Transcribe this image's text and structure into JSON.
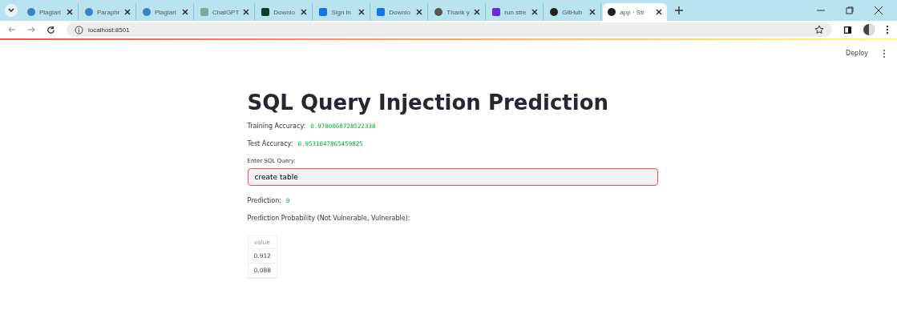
{
  "browser": {
    "tabs": [
      {
        "label": "Plagiari",
        "selected": false
      },
      {
        "label": "Paraphr",
        "selected": false
      },
      {
        "label": "Plagiari",
        "selected": false
      },
      {
        "label": "ChatGPT",
        "selected": false
      },
      {
        "label": "Downlo",
        "selected": false
      },
      {
        "label": "Sign in",
        "selected": false
      },
      {
        "label": "Downlo",
        "selected": false
      },
      {
        "label": "Thank y",
        "selected": false
      },
      {
        "label": "run stre",
        "selected": false
      },
      {
        "label": "GitHub",
        "selected": false
      },
      {
        "label": "app · Str",
        "selected": true
      }
    ],
    "address": "localhost:8501"
  },
  "header": {
    "deploy": "Deploy"
  },
  "title": "SQL Query Injection Prediction",
  "metrics": [
    {
      "label": "Training Accuracy:",
      "value": "0.9780068728522338"
    },
    {
      "label": "Test Accuracy:",
      "value": "0.9531047865459825"
    }
  ],
  "query": {
    "label": "Enter SQL Query:",
    "value": "create table"
  },
  "prediction": {
    "label": "Prediction:",
    "value": "0"
  },
  "probability_label": "Prediction Probability (Not Vulnerable, Vulnerable):",
  "table": {
    "columns": [
      "value"
    ],
    "rows": [
      [
        "0.912"
      ],
      [
        "0.088"
      ]
    ]
  }
}
